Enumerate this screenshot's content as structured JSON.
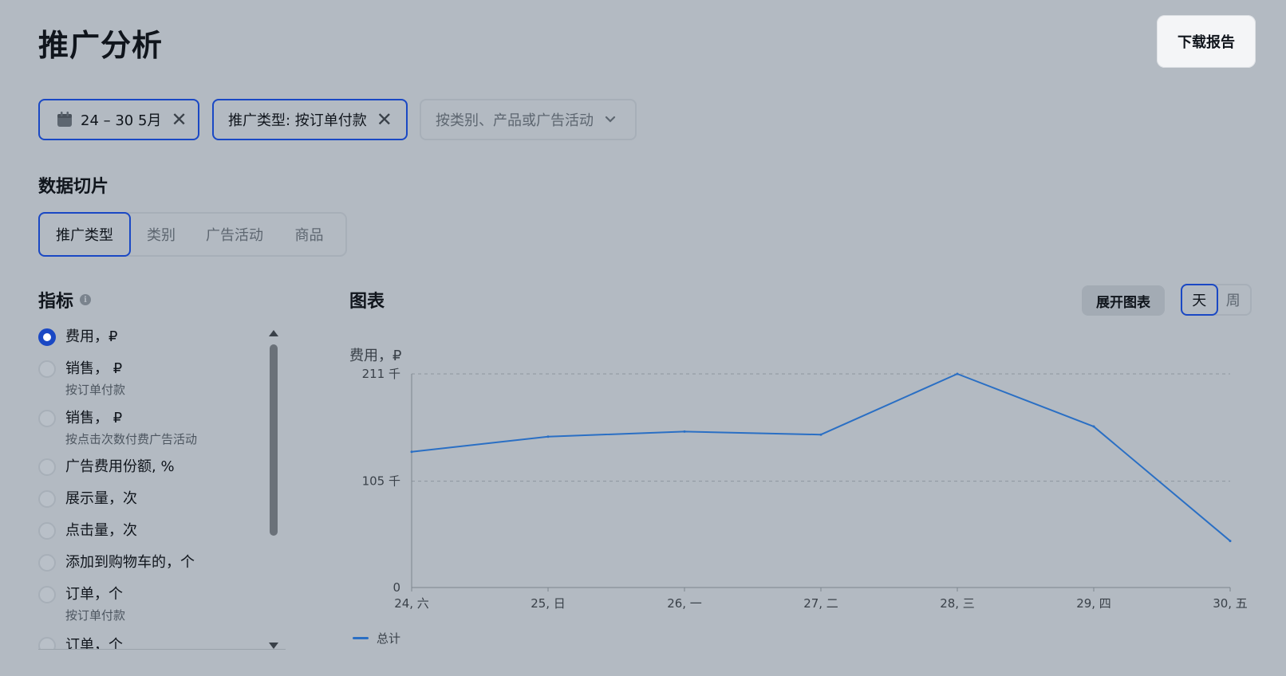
{
  "header": {
    "title": "推广分析",
    "download_label": "下载报告"
  },
  "filters": [
    {
      "label": "24 – 30 5月",
      "icon": "calendar-icon",
      "active": true
    },
    {
      "label": "推广类型: 按订单付款",
      "active": true
    },
    {
      "label": "按类别、产品或广告活动",
      "icon": "chevron-down-icon",
      "active": false
    }
  ],
  "data_slice": {
    "title": "数据切片",
    "tabs": [
      "推广类型",
      "类别",
      "广告活动",
      "商品"
    ],
    "active_tab": "推广类型"
  },
  "metrics": {
    "title": "指标",
    "items": [
      {
        "label": "费用，₽",
        "sub": "",
        "checked": true
      },
      {
        "label": "销售， ₽",
        "sub": "按订单付款",
        "checked": false
      },
      {
        "label": "销售， ₽",
        "sub": "按点击次数付费广告活动",
        "checked": false
      },
      {
        "label": "广告费用份额, %",
        "sub": "",
        "checked": false
      },
      {
        "label": "展示量，次",
        "sub": "",
        "checked": false
      },
      {
        "label": "点击量，次",
        "sub": "",
        "checked": false
      },
      {
        "label": "添加到购物车的，个",
        "sub": "",
        "checked": false
      },
      {
        "label": "订单，个",
        "sub": "按订单付款",
        "checked": false
      },
      {
        "label": "订单，个",
        "sub": "",
        "checked": false
      }
    ]
  },
  "chart_panel": {
    "title": "图表",
    "expand_label": "展开图表",
    "period_options": [
      "天",
      "周"
    ],
    "active_period": "天"
  },
  "chart_data": {
    "type": "line",
    "ylabel": "费用，₽",
    "x": [
      "24, 六",
      "25, 日",
      "26, 一",
      "27, 二",
      "28, 三",
      "29, 四",
      "30, 五"
    ],
    "ylim": [
      0,
      211000
    ],
    "yticks": [
      {
        "value": 0,
        "label": "0"
      },
      {
        "value": 105000,
        "label": "105 千"
      },
      {
        "value": 211000,
        "label": "211 千"
      }
    ],
    "series": [
      {
        "name": "总计",
        "color": "#2a6fc4",
        "values": [
          134000,
          149000,
          154000,
          151000,
          211000,
          159000,
          46000
        ]
      }
    ],
    "grid": "horizontal dashed",
    "legend": "bottom-left"
  }
}
